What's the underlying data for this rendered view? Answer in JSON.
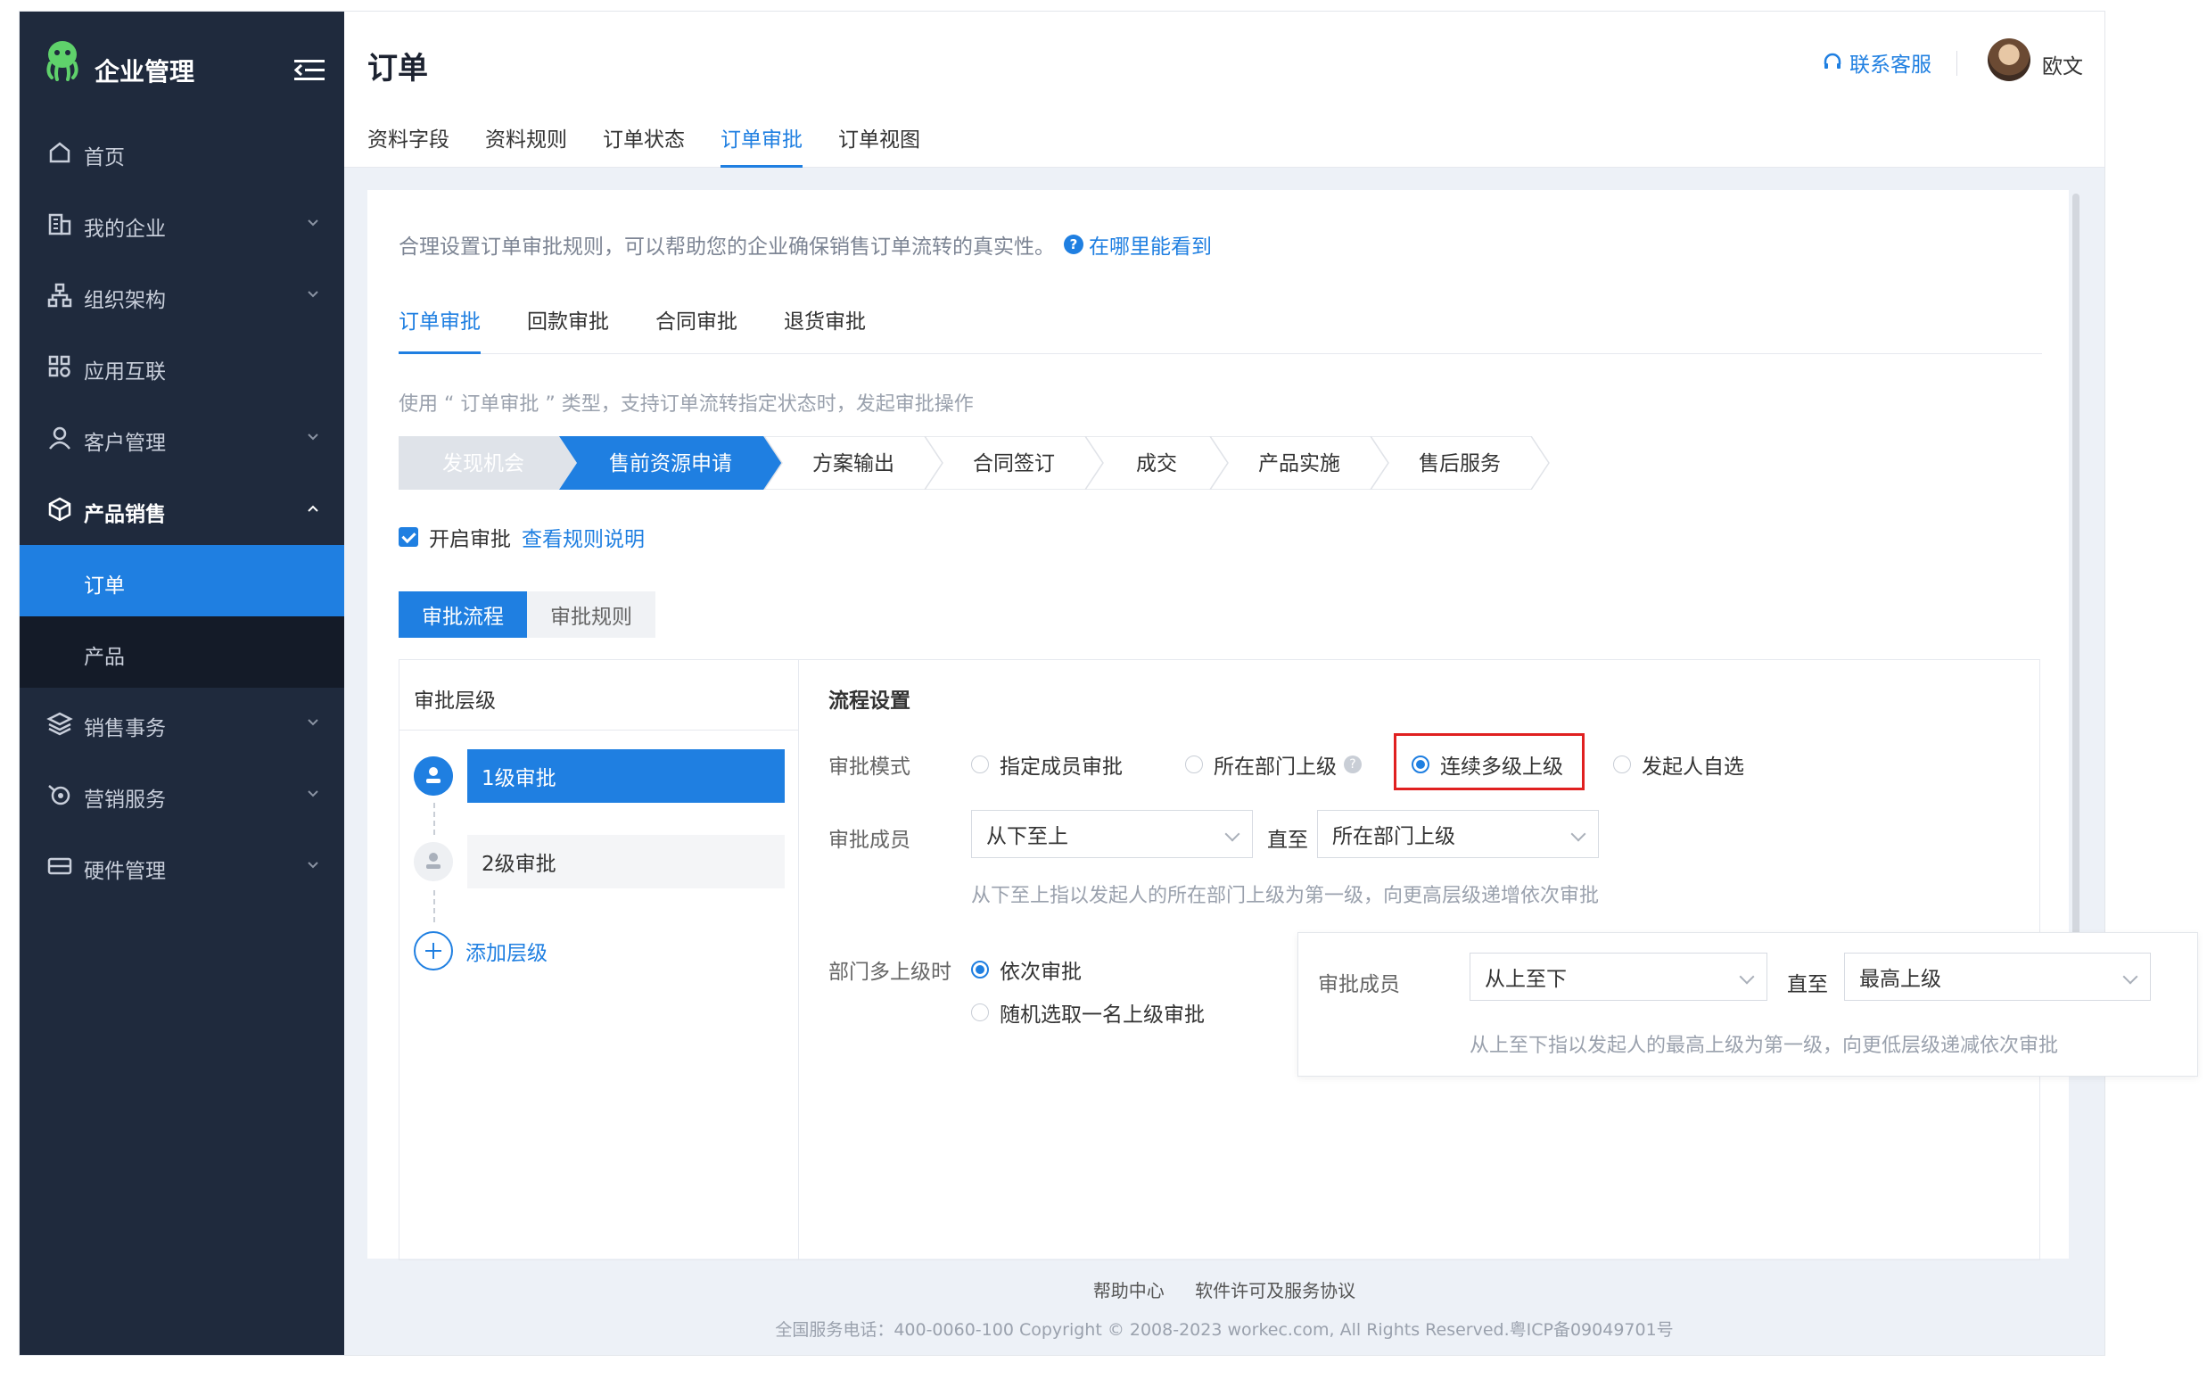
{
  "brand": {
    "name": "企业管理"
  },
  "sidebar": {
    "items": [
      {
        "label": "首页",
        "icon": "home-icon"
      },
      {
        "label": "我的企业",
        "icon": "building-icon"
      },
      {
        "label": "组织架构",
        "icon": "org-chart-icon"
      },
      {
        "label": "应用互联",
        "icon": "apps-icon"
      },
      {
        "label": "客户管理",
        "icon": "user-icon"
      },
      {
        "label": "产品销售",
        "icon": "box-icon"
      }
    ],
    "sub_items": [
      {
        "label": "订单"
      },
      {
        "label": "产品"
      }
    ],
    "items_after": [
      {
        "label": "销售事务",
        "icon": "layers-icon"
      },
      {
        "label": "营销服务",
        "icon": "marketing-icon"
      },
      {
        "label": "硬件管理",
        "icon": "hardware-icon"
      }
    ]
  },
  "header": {
    "title": "订单",
    "service_label": "联系客服",
    "username": "欧文",
    "tabs": [
      "资料字段",
      "资料规则",
      "订单状态",
      "订单审批",
      "订单视图"
    ],
    "active_tab": "订单审批"
  },
  "content": {
    "intro": "合理设置订单审批规则，可以帮助您的企业确保销售订单流转的真实性。",
    "intro_link": "在哪里能看到",
    "subtabs": [
      "订单审批",
      "回款审批",
      "合同审批",
      "退货审批"
    ],
    "hint": "使用 “ 订单审批 ” 类型，支持订单流转指定状态时，发起审批操作",
    "steps": [
      "发现机会",
      "售前资源申请",
      "方案输出",
      "合同签订",
      "成交",
      "产品实施",
      "售后服务"
    ],
    "checkbox_label": "开启审批",
    "rules_link": "查看规则说明",
    "segments": [
      "审批流程",
      "审批规则"
    ],
    "levels_title": "审批层级",
    "levels": [
      "1级审批",
      "2级审批"
    ],
    "add_level": "添加层级",
    "settings": {
      "title": "流程设置",
      "mode_label": "审批模式",
      "modes": [
        "指定成员审批",
        "所在部门上级",
        "连续多级上级",
        "发起人自选"
      ],
      "members_label": "审批成员",
      "from_select": "从下至上",
      "until_label": "直至",
      "to_select": "所在部门上级",
      "members_hint": "从下至上指以发起人的所在部门上级为第一级，向更高层级递增依次审批",
      "multi_label": "部门多上级时",
      "multi_options": [
        "依次审批",
        "随机选取一名上级审批"
      ]
    },
    "popover": {
      "members_label": "审批成员",
      "from_select": "从上至下",
      "until_label": "直至",
      "to_select": "最高上级",
      "hint": "从上至下指以发起人的最高上级为第一级，向更低层级递减依次审批"
    }
  },
  "footer": {
    "links": [
      "帮助中心",
      "软件许可及服务协议"
    ],
    "copyright": "全国服务电话：400-0060-100 Copyright © 2008-2023 workec.com, All Rights Reserved.粤ICP备09049701号"
  },
  "colors": {
    "accent": "#1f7fe1",
    "sidebar": "#1f2a3d",
    "highlight": "#e02020",
    "logo": "#5fd16b"
  }
}
